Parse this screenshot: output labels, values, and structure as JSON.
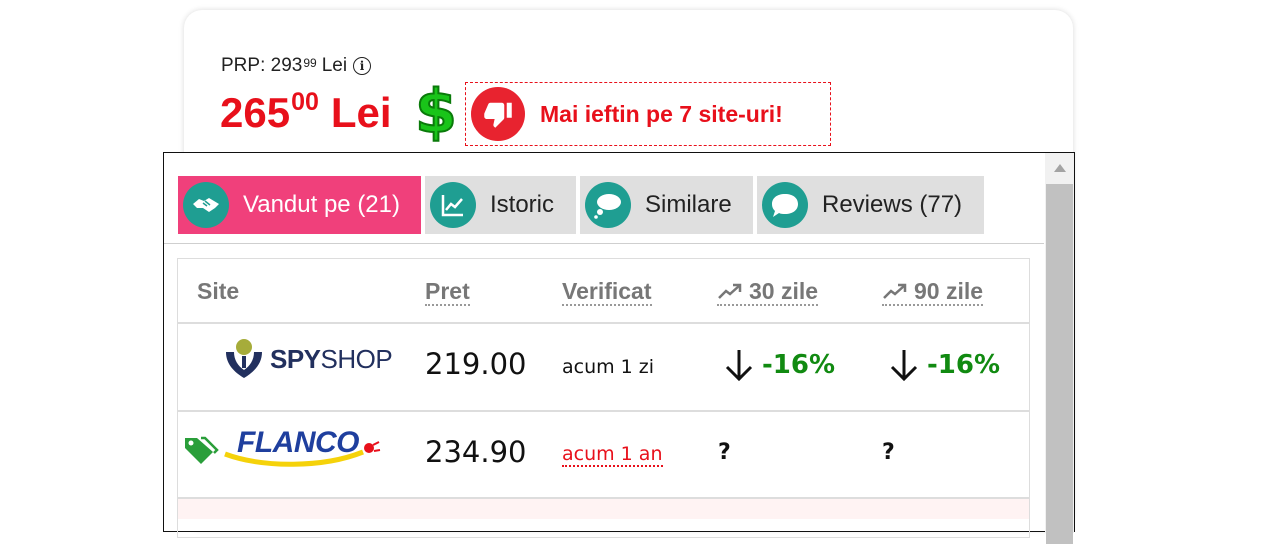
{
  "header": {
    "prp_label": "PRP:",
    "prp_int": "293",
    "prp_dec": "99",
    "prp_currency": "Lei",
    "price_int": "265",
    "price_dec": "00",
    "price_currency": "Lei",
    "alert_text": "Mai ieftin pe 7 site-uri!"
  },
  "tabs": [
    {
      "label": "Vandut pe (21)",
      "icon": "handshake-icon",
      "active": true
    },
    {
      "label": "Istoric",
      "icon": "chart-icon",
      "active": false
    },
    {
      "label": "Similare",
      "icon": "thought-bubble-icon",
      "active": false
    },
    {
      "label": "Reviews (77)",
      "icon": "speech-bubble-icon",
      "active": false
    }
  ],
  "table": {
    "columns": [
      "Site",
      "Pret",
      "Verificat",
      "30 zile",
      "90 zile"
    ],
    "rows": [
      {
        "site_logo": "SPYSHOP",
        "site_logo_bold": "SPY",
        "site_logo_rest": "SHOP",
        "price": "219.00",
        "verified": "acum 1 zi",
        "trend30": "-16%",
        "trend90": "-16%"
      },
      {
        "site_logo": "FLANCO",
        "price": "234.90",
        "verified": "acum 1 an",
        "trend30": "?",
        "trend90": "?"
      }
    ]
  },
  "colors": {
    "price_red": "#e8101b",
    "tab_active": "#f0407b",
    "icon_teal": "#1f9e92",
    "trend_green": "#118a11",
    "dollar_green": "#19c419"
  }
}
